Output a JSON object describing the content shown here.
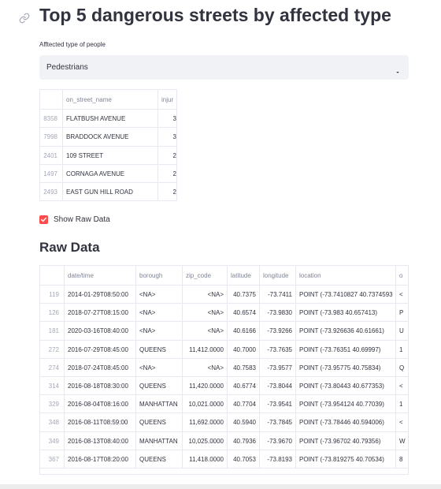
{
  "title": "Top 5 dangerous streets by affected type",
  "selector": {
    "label": "Afftected type of people",
    "value": "Pedestrians"
  },
  "top_table": {
    "headers": [
      "",
      "on_street_name",
      "injur"
    ],
    "rows": [
      [
        "8358",
        "FLATBUSH AVENUE",
        "3"
      ],
      [
        "7998",
        "BRADDOCK AVENUE",
        "3"
      ],
      [
        "2401",
        "109 STREET",
        "2"
      ],
      [
        "1497",
        "CORNAGA AVENUE",
        "2"
      ],
      [
        "2493",
        "EAST GUN HILL ROAD",
        "2"
      ]
    ]
  },
  "checkbox": {
    "label": "Show Raw Data",
    "checked": true
  },
  "raw_heading": "Raw Data",
  "raw_table": {
    "headers": [
      "",
      "date/time",
      "borough",
      "zip_code",
      "latitude",
      "longitude",
      "location",
      "o"
    ],
    "rows": [
      [
        "119",
        "2014-01-29T08:50:00",
        "<NA>",
        "<NA>",
        "40.7375",
        "-73.7411",
        "POINT (-73.7410827 40.7374593",
        "<"
      ],
      [
        "126",
        "2018-07-27T08:15:00",
        "<NA>",
        "<NA>",
        "40.6574",
        "-73.9830",
        "POINT (-73.983 40.657413)",
        "P"
      ],
      [
        "181",
        "2020-03-16T08:40:00",
        "<NA>",
        "<NA>",
        "40.6166",
        "-73.9266",
        "POINT (-73.926636 40.61661)",
        "U"
      ],
      [
        "272",
        "2016-07-29T08:45:00",
        "QUEENS",
        "11,412.0000",
        "40.7000",
        "-73.7635",
        "POINT (-73.76351 40.69997)",
        "1"
      ],
      [
        "274",
        "2018-07-24T08:45:00",
        "<NA>",
        "<NA>",
        "40.7583",
        "-73.9577",
        "POINT (-73.95775 40.75834)",
        "Q"
      ],
      [
        "314",
        "2016-08-18T08:30:00",
        "QUEENS",
        "11,420.0000",
        "40.6774",
        "-73.8044",
        "POINT (-73.80443 40.677353)",
        "<"
      ],
      [
        "329",
        "2016-08-04T08:16:00",
        "MANHATTAN",
        "10,021.0000",
        "40.7704",
        "-73.9541",
        "POINT (-73.954124 40.77039)",
        "1"
      ],
      [
        "348",
        "2016-08-11T08:59:00",
        "QUEENS",
        "11,692.0000",
        "40.5940",
        "-73.7845",
        "POINT (-73.78446 40.594006)",
        "<"
      ],
      [
        "349",
        "2016-08-13T08:40:00",
        "MANHATTAN",
        "10,025.0000",
        "40.7936",
        "-73.9670",
        "POINT (-73.96702 40.79356)",
        "W"
      ],
      [
        "367",
        "2016-08-17T08:20:00",
        "QUEENS",
        "11,418.0000",
        "40.7053",
        "-73.8193",
        "POINT (-73.819275 40.70534)",
        "8"
      ]
    ]
  }
}
